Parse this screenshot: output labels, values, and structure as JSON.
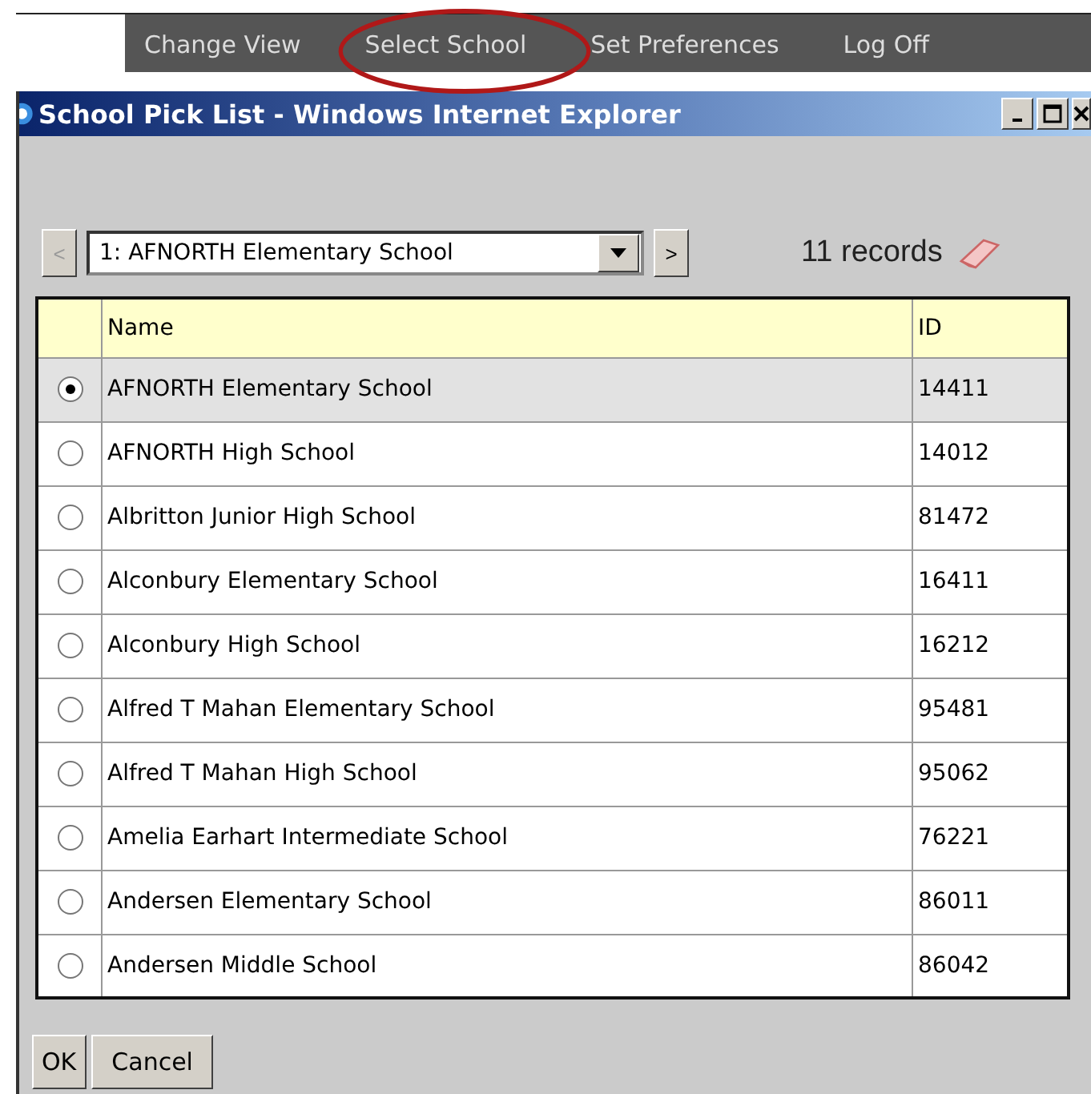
{
  "nav": [
    {
      "label": "Change View",
      "circled": false
    },
    {
      "label": "Select School",
      "circled": true
    },
    {
      "label": "Set Preferences",
      "circled": false
    },
    {
      "label": "Log Off",
      "circled": false
    }
  ],
  "window": {
    "title": "School Pick List - Windows Internet Explorer"
  },
  "pager": {
    "prev": "<",
    "next": ">",
    "prev_disabled": true,
    "current": "1: AFNORTH Elementary School",
    "records": "11 records"
  },
  "table": {
    "columns": [
      "Name",
      "ID"
    ],
    "rows": [
      {
        "name": "AFNORTH Elementary School",
        "id": "14411",
        "selected": true
      },
      {
        "name": "AFNORTH High School",
        "id": "14012",
        "selected": false
      },
      {
        "name": "Albritton Junior High School",
        "id": "81472",
        "selected": false
      },
      {
        "name": "Alconbury Elementary School",
        "id": "16411",
        "selected": false
      },
      {
        "name": "Alconbury High School",
        "id": "16212",
        "selected": false
      },
      {
        "name": "Alfred T Mahan Elementary School",
        "id": "95481",
        "selected": false
      },
      {
        "name": "Alfred T Mahan High School",
        "id": "95062",
        "selected": false
      },
      {
        "name": "Amelia Earhart Intermediate School",
        "id": "76221",
        "selected": false
      },
      {
        "name": "Andersen Elementary School",
        "id": "86011",
        "selected": false
      },
      {
        "name": "Andersen Middle School",
        "id": "86042",
        "selected": false
      }
    ]
  },
  "buttons": [
    "OK",
    "Cancel"
  ]
}
